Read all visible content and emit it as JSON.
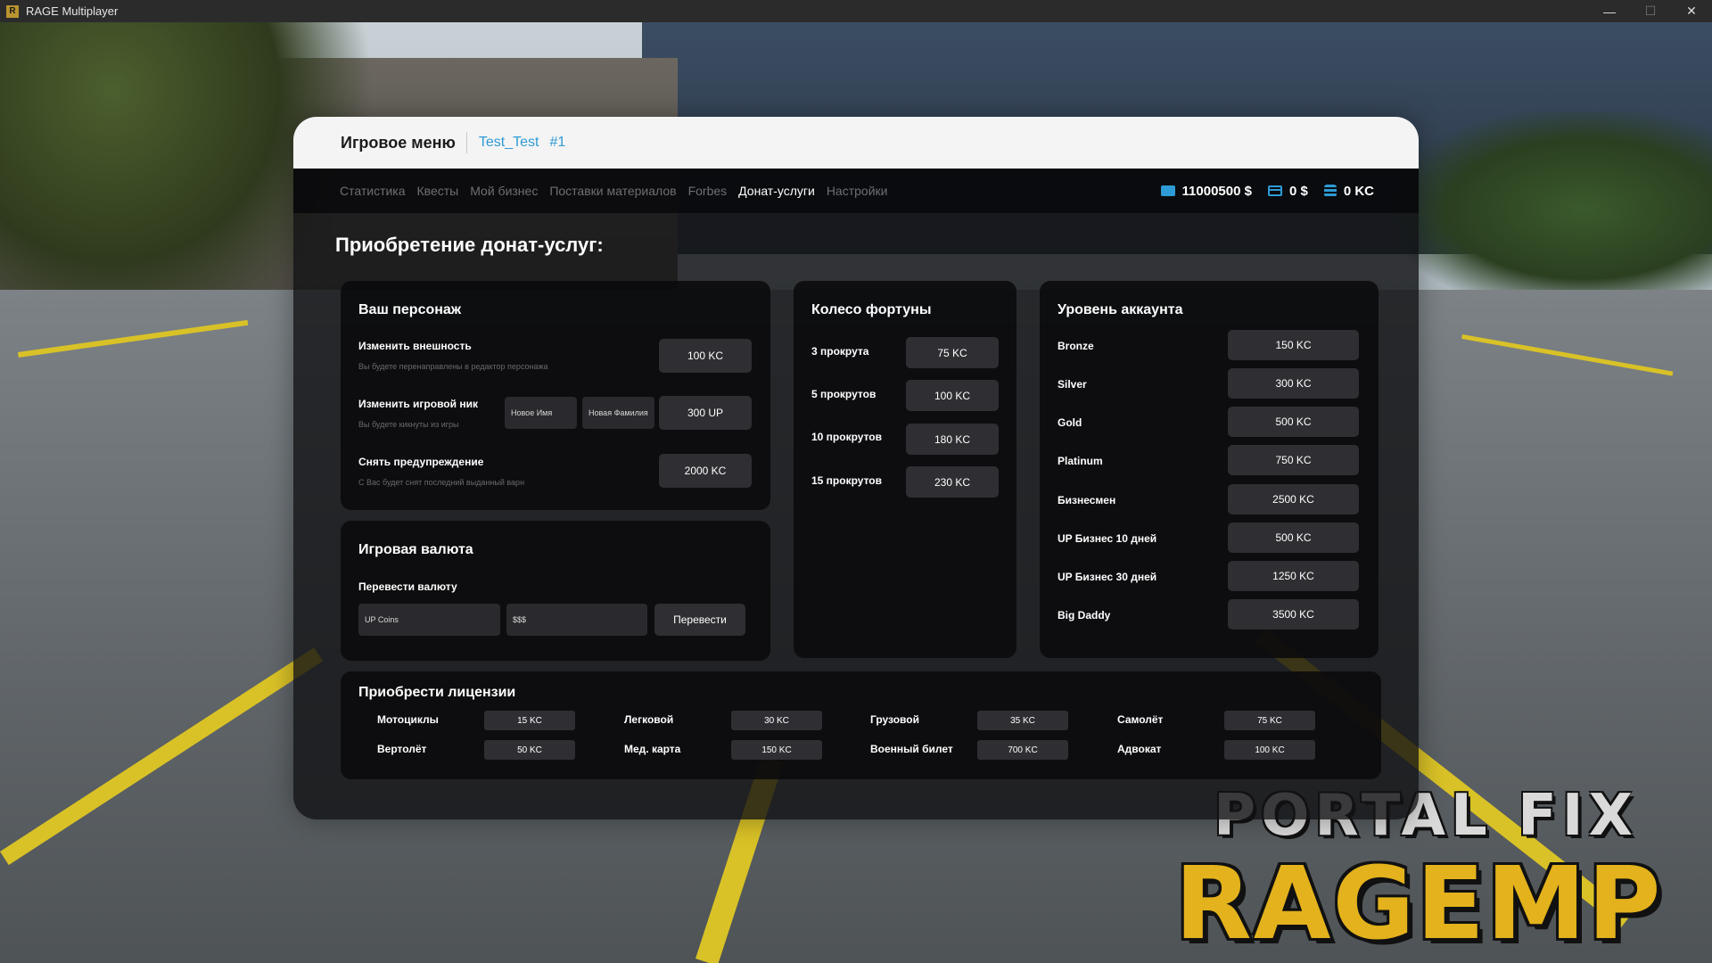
{
  "window": {
    "title": "RAGE Multiplayer",
    "app_icon_letter": "R",
    "controls": {
      "minimize": "—",
      "maximize": "☐",
      "close": "✕"
    }
  },
  "menu": {
    "title": "Игровое меню",
    "player_name": "Test_Test",
    "player_id": "#1"
  },
  "nav": {
    "tabs": [
      "Статистика",
      "Квесты",
      "Мой бизнес",
      "Поставки материалов",
      "Forbes",
      "Донат-услуги",
      "Настройки"
    ],
    "active_tab": "Донат-услуги",
    "balances": {
      "cash": "11000500 $",
      "bank": "0 $",
      "coins": "0 KC"
    },
    "accent_color": "#2e9bd6"
  },
  "page_title": "Приобретение донат-услуг:",
  "character": {
    "title": "Ваш персонаж",
    "rows": [
      {
        "label": "Изменить внешность",
        "sub": "Вы будете перенаправлены в редактор персонажа",
        "price": "100 KC"
      },
      {
        "label": "Изменить игровой ник",
        "sub": "Вы будете кикнуты из игры",
        "price": "300 UP",
        "first_name_placeholder": "Новое Имя",
        "last_name_placeholder": "Новая Фамилия"
      },
      {
        "label": "Снять предупреждение",
        "sub": "С Вас будет снят последний выданный варн",
        "price": "2000 KC"
      }
    ]
  },
  "currency": {
    "title": "Игровая валюта",
    "subtitle": "Перевести валюту",
    "from_placeholder": "UP Coins",
    "to_placeholder": "$$$",
    "button": "Перевести"
  },
  "wheel": {
    "title": "Колесо фортуны",
    "rows": [
      {
        "label": "3 прокрута",
        "price": "75 KC"
      },
      {
        "label": "5 прокрутов",
        "price": "100 KC"
      },
      {
        "label": "10 прокрутов",
        "price": "180 KC"
      },
      {
        "label": "15 прокрутов",
        "price": "230 KC"
      }
    ]
  },
  "account": {
    "title": "Уровень аккаунта",
    "rows": [
      {
        "label": "Bronze",
        "price": "150 KC"
      },
      {
        "label": "Silver",
        "price": "300 KC"
      },
      {
        "label": "Gold",
        "price": "500 KC"
      },
      {
        "label": "Platinum",
        "price": "750 KC"
      },
      {
        "label": "Бизнесмен",
        "price": "2500 KC"
      },
      {
        "label": "UP Бизнес 10 дней",
        "price": "500 KC"
      },
      {
        "label": "UP Бизнес 30 дней",
        "price": "1250 KC"
      },
      {
        "label": "Big Daddy",
        "price": "3500 KC"
      }
    ]
  },
  "licenses": {
    "title": "Приобрести лицензии",
    "items": [
      {
        "label": "Мотоциклы",
        "price": "15 KC"
      },
      {
        "label": "Легковой",
        "price": "30 KC"
      },
      {
        "label": "Грузовой",
        "price": "35 KC"
      },
      {
        "label": "Самолёт",
        "price": "75 KC"
      },
      {
        "label": "Вертолёт",
        "price": "50 KC"
      },
      {
        "label": "Мед. карта",
        "price": "150 KC"
      },
      {
        "label": "Военный билет",
        "price": "700 KC"
      },
      {
        "label": "Адвокат",
        "price": "100 KC"
      }
    ]
  },
  "watermark": {
    "top": "PORTAL FIX",
    "bottom": "RAGEMP"
  }
}
